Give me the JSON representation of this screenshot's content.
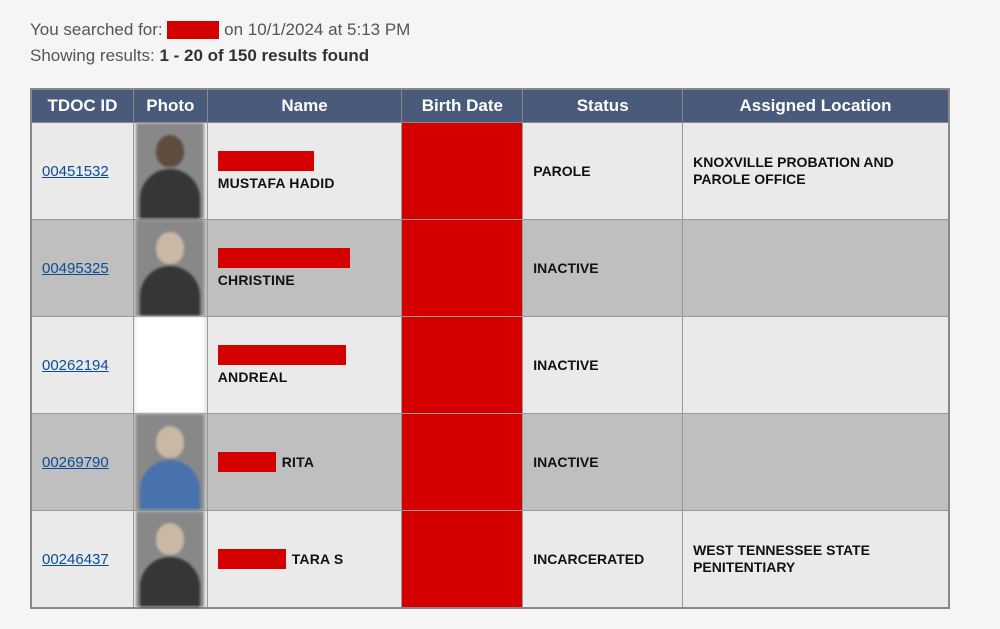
{
  "search_header": {
    "prefix": "You searched for:",
    "on_text": " on ",
    "date": "10/1/2024",
    "at_text": " at ",
    "time": "5:13 PM"
  },
  "results_summary": {
    "prefix": "Showing results: ",
    "range_and_total": "1 - 20 of 150 results found"
  },
  "columns": {
    "id": "TDOC ID",
    "photo": "Photo",
    "name": "Name",
    "birth": "Birth Date",
    "status": "Status",
    "location": "Assigned Location"
  },
  "rows": [
    {
      "id": "00451532",
      "name_redact_width": 96,
      "name_after_redact_width": 0,
      "name_visible": "MUSTAFA HADID",
      "status": "PAROLE",
      "location": "KNOXVILLE PROBATION AND PAROLE OFFICE",
      "photo_variant": "dark"
    },
    {
      "id": "00495325",
      "name_redact_width": 132,
      "name_after_redact_width": 0,
      "name_visible": "CHRISTINE",
      "status": "INACTIVE",
      "location": "",
      "photo_variant": "light"
    },
    {
      "id": "00262194",
      "name_redact_width": 128,
      "name_after_redact_width": 0,
      "name_visible": "ANDREAL",
      "status": "INACTIVE",
      "location": "",
      "photo_variant": "white"
    },
    {
      "id": "00269790",
      "name_redact_width": 0,
      "name_after_redact_width": 58,
      "name_visible": "RITA",
      "status": "INACTIVE",
      "location": "",
      "photo_variant": "blue"
    },
    {
      "id": "00246437",
      "name_redact_width": 0,
      "name_after_redact_width": 68,
      "name_visible": "TARA S",
      "status": "INCARCERATED",
      "location": "WEST TENNESSEE STATE PENITENTIARY",
      "photo_variant": "plate"
    }
  ]
}
